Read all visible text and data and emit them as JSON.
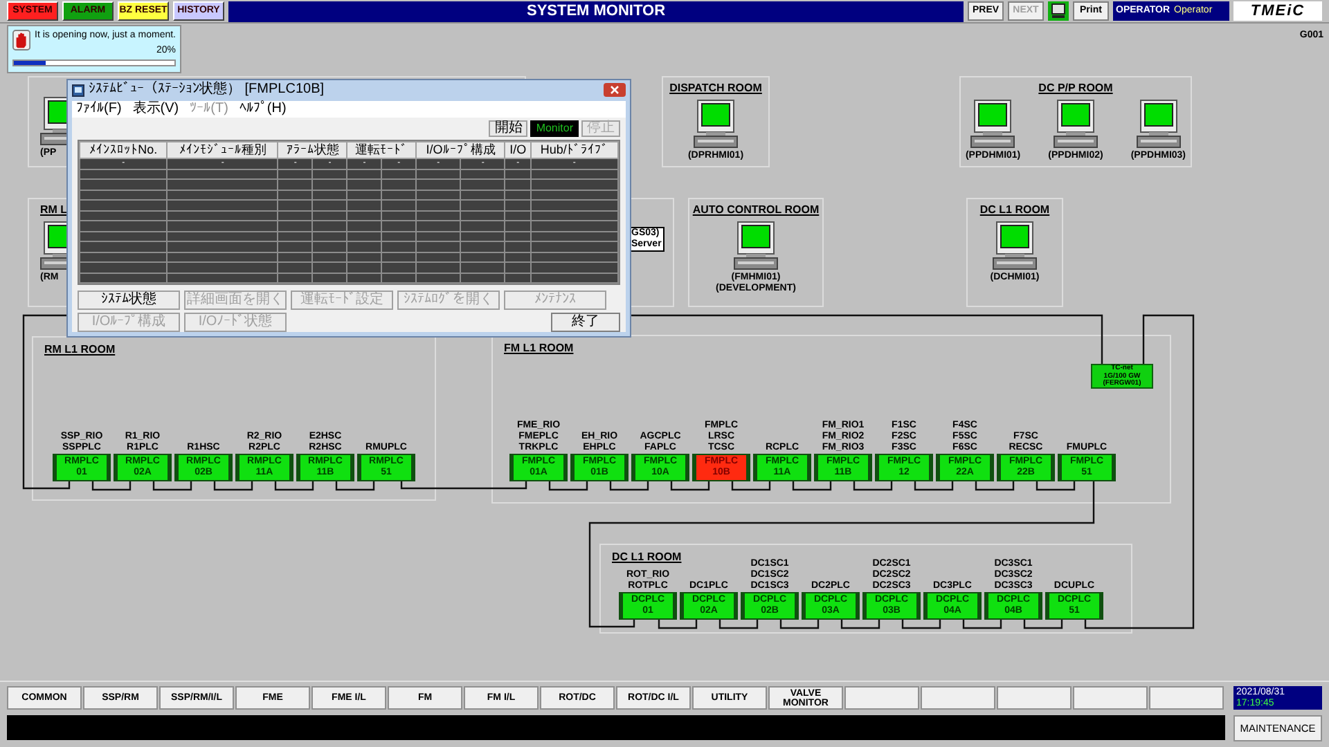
{
  "header": {
    "buttons": [
      {
        "label": "SYSTEM",
        "color": "#ff2020"
      },
      {
        "label": "ALARM",
        "color": "#10a010"
      },
      {
        "label": "BZ RESET",
        "color": "#ffff40"
      },
      {
        "label": "HISTORY",
        "color": "#c8c8ff"
      }
    ],
    "title": "SYSTEM MONITOR",
    "nav": [
      {
        "label": "PREV",
        "disabled": false
      },
      {
        "label": "NEXT",
        "disabled": true
      }
    ],
    "print": "Print",
    "operator": {
      "role": "OPERATOR",
      "name": "Operator"
    },
    "logo": "TMEiC"
  },
  "notice": {
    "message": "It is opening now, just a moment.",
    "percent": "20%",
    "level": 0.2
  },
  "screen_id": "G001",
  "hmi_rooms": [
    {
      "terminals": [
        {
          "lines": [
            "(PP"
          ]
        }
      ]
    },
    {
      "title": "DISPATCH ROOM",
      "terminals": [
        {
          "lines": [
            "(DPRHMI01)"
          ]
        }
      ]
    },
    {
      "title": "DC P/P ROOM",
      "terminals": [
        {
          "lines": [
            "(PPDHMI01)"
          ]
        },
        {
          "lines": [
            "(PPDHMI02)"
          ]
        },
        {
          "lines": [
            "(PPDHMI03)"
          ]
        }
      ]
    },
    {
      "title": "RM L",
      "terminals": [
        {
          "lines": [
            "(RM"
          ]
        }
      ],
      "server": {
        "lines": [
          "GS03)",
          "Server"
        ]
      }
    },
    {
      "title": "AUTO CONTROL ROOM",
      "terminals": [
        {
          "lines": [
            "(FMHMI01)",
            "(DEVELOPMENT)"
          ]
        }
      ]
    },
    {
      "title": "DC L1 ROOM",
      "terminals": [
        {
          "lines": [
            "(DCHMI01)"
          ]
        }
      ]
    }
  ],
  "gateway": {
    "lines": [
      "TC-net",
      "1G/100 GW",
      "(FERGW01)"
    ]
  },
  "plc_rooms": [
    {
      "title": "RM L1 ROOM",
      "plcs": [
        {
          "tags": [
            "SSP_RIO",
            "SSPPLC"
          ],
          "name": "RMPLC",
          "number": "01",
          "fault": false
        },
        {
          "tags": [
            "R1_RIO",
            "R1PLC"
          ],
          "name": "RMPLC",
          "number": "02A",
          "fault": false
        },
        {
          "tags": [
            "R1HSC"
          ],
          "name": "RMPLC",
          "number": "02B",
          "fault": false
        },
        {
          "tags": [
            "R2_RIO",
            "R2PLC"
          ],
          "name": "RMPLC",
          "number": "11A",
          "fault": false
        },
        {
          "tags": [
            "E2HSC",
            "R2HSC"
          ],
          "name": "RMPLC",
          "number": "11B",
          "fault": false
        },
        {
          "tags": [
            "RMUPLC"
          ],
          "name": "RMPLC",
          "number": "51",
          "fault": false
        }
      ]
    },
    {
      "title": "FM L1 ROOM",
      "plcs": [
        {
          "tags": [
            "FME_RIO",
            "FMEPLC",
            "TRKPLC"
          ],
          "name": "FMPLC",
          "number": "01A",
          "fault": false
        },
        {
          "tags": [
            "EH_RIO",
            "EHPLC"
          ],
          "name": "FMPLC",
          "number": "01B",
          "fault": false
        },
        {
          "tags": [
            "AGCPLC",
            "FAPLC"
          ],
          "name": "FMPLC",
          "number": "10A",
          "fault": false
        },
        {
          "tags": [
            "FMPLC",
            "LRSC",
            "TCSC"
          ],
          "name": "FMPLC",
          "number": "10B",
          "fault": true
        },
        {
          "tags": [
            "RCPLC"
          ],
          "name": "FMPLC",
          "number": "11A",
          "fault": false
        },
        {
          "tags": [
            "FM_RIO1",
            "FM_RIO2",
            "FM_RIO3"
          ],
          "name": "FMPLC",
          "number": "11B",
          "fault": false
        },
        {
          "tags": [
            "F1SC",
            "F2SC",
            "F3SC"
          ],
          "name": "FMPLC",
          "number": "12",
          "fault": false
        },
        {
          "tags": [
            "F4SC",
            "F5SC",
            "F6SC"
          ],
          "name": "FMPLC",
          "number": "22A",
          "fault": false
        },
        {
          "tags": [
            "F7SC",
            "RECSC"
          ],
          "name": "FMPLC",
          "number": "22B",
          "fault": false
        },
        {
          "tags": [
            "FMUPLC"
          ],
          "name": "FMPLC",
          "number": "51",
          "fault": false
        }
      ]
    },
    {
      "title": "DC L1 ROOM",
      "plcs": [
        {
          "tags": [
            "ROT_RIO",
            "ROTPLC"
          ],
          "name": "DCPLC",
          "number": "01",
          "fault": false
        },
        {
          "tags": [
            "DC1PLC"
          ],
          "name": "DCPLC",
          "number": "02A",
          "fault": false
        },
        {
          "tags": [
            "DC1SC1",
            "DC1SC2",
            "DC1SC3"
          ],
          "name": "DCPLC",
          "number": "02B",
          "fault": false
        },
        {
          "tags": [
            "DC2PLC"
          ],
          "name": "DCPLC",
          "number": "03A",
          "fault": false
        },
        {
          "tags": [
            "DC2SC1",
            "DC2SC2",
            "DC2SC3"
          ],
          "name": "DCPLC",
          "number": "03B",
          "fault": false
        },
        {
          "tags": [
            "DC3PLC"
          ],
          "name": "DCPLC",
          "number": "04A",
          "fault": false
        },
        {
          "tags": [
            "DC3SC1",
            "DC3SC2",
            "DC3SC3"
          ],
          "name": "DCPLC",
          "number": "04B",
          "fault": false
        },
        {
          "tags": [
            "DCUPLC"
          ],
          "name": "DCPLC",
          "number": "51",
          "fault": false
        }
      ]
    }
  ],
  "popup": {
    "title": "ｼｽﾃﾑﾋﾞｭｰ（ｽﾃｰｼｮﾝ状態） [FMPLC10B]",
    "menu": [
      {
        "label": "ﾌｧｲﾙ(F)",
        "disabled": false
      },
      {
        "label": "表示(V)",
        "disabled": false
      },
      {
        "label": "ﾂｰﾙ(T)",
        "disabled": true
      },
      {
        "label": "ﾍﾙﾌﾟ(H)",
        "disabled": false
      }
    ],
    "start": {
      "label": "開始",
      "disabled": false
    },
    "monitor": "Monitor",
    "stop": {
      "label": "停止",
      "disabled": true
    },
    "columns": [
      "ﾒｲﾝｽﾛｯﾄNo.",
      "ﾒｲﾝﾓｼﾞｭｰﾙ種別",
      "ｱﾗｰﾑ状態",
      "運転ﾓｰﾄﾞ",
      "I/Oﾙｰﾌﾟ構成",
      "I/O",
      "Hub/ﾄﾞﾗｲﾌﾞ"
    ],
    "row": [
      "-",
      "-",
      "-",
      "-",
      "-",
      "-",
      "-",
      "-",
      "-",
      "-"
    ],
    "buttons_row1": [
      {
        "label": "ｼｽﾃﾑ状態",
        "disabled": false
      },
      {
        "label": "詳細画面を開く",
        "disabled": true
      },
      {
        "label": "運転ﾓｰﾄﾞ設定",
        "disabled": true
      },
      {
        "label": "ｼｽﾃﾑﾛｸﾞを開く",
        "disabled": true
      },
      {
        "label": "ﾒﾝﾃﾅﾝｽ",
        "disabled": true
      }
    ],
    "buttons_row2": [
      {
        "label": "I/Oﾙｰﾌﾟ構成",
        "disabled": true
      },
      {
        "label": "I/Oﾉｰﾄﾞ状態",
        "disabled": true
      }
    ],
    "close_button": "終了"
  },
  "footer": {
    "tabs": [
      "COMMON",
      "SSP/RM",
      "SSP/RM/I/L",
      "FME",
      "FME I/L",
      "FM",
      "FM I/L",
      "ROT/DC",
      "ROT/DC I/L",
      "UTILITY",
      "VALVE MONITOR"
    ],
    "date": "2021/08/31",
    "time": "17:19:45",
    "maintenance": "MAINTENANCE"
  }
}
